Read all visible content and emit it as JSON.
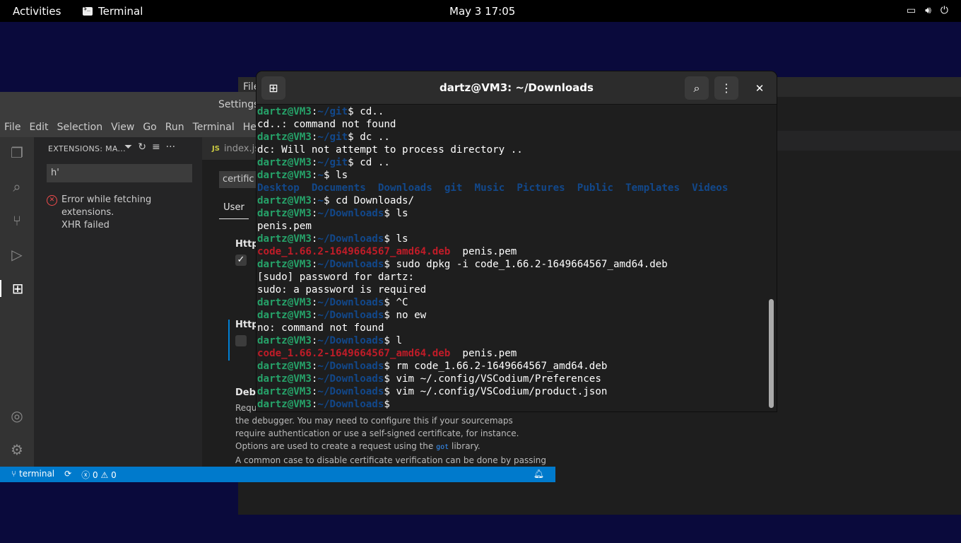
{
  "topbar": {
    "activities": "Activities",
    "app_name": "Terminal",
    "clock": "May 3  17:05",
    "tray": [
      "screen-icon",
      "volume-icon",
      "power-icon"
    ]
  },
  "bg_window": {
    "menu_first": "File"
  },
  "vscode": {
    "title": "Settings",
    "menu": [
      "File",
      "Edit",
      "Selection",
      "View",
      "Go",
      "Run",
      "Terminal",
      "He"
    ],
    "sidebar": {
      "header": "EXTENSIONS: MA...",
      "search_value": "h'",
      "error_line1": "Error while fetching extensions.",
      "error_line2": "XHR failed"
    },
    "editor": {
      "tab": "index.js",
      "tab_lang": "JS",
      "search_value": "certific",
      "user_tab": "User",
      "setting1_header": "Http:",
      "setting2_header": "Http:",
      "setting3_header": "Debu",
      "desc_line1": "Requ",
      "desc_line2": "the debugger. You may need to configure this if your sourcemaps",
      "desc_line3": "require authentication or use a self-signed certificate, for instance.",
      "desc_line4a": "Options are used to create a request using the ",
      "desc_code": "got",
      "desc_line4b": " library.",
      "desc_line5": "A common case to disable certificate verification can be done by passing"
    },
    "status": {
      "branch": "terminal",
      "errors": "0",
      "warnings": "0"
    }
  },
  "terminal": {
    "title": "dartz@VM3: ~/Downloads",
    "lines": [
      [
        {
          "t": "dartz@VM3",
          "c": "u"
        },
        {
          "t": ":",
          "c": ""
        },
        {
          "t": "~/git",
          "c": "p"
        },
        {
          "t": "$ cd..",
          "c": ""
        }
      ],
      [
        {
          "t": "cd..: command not found",
          "c": ""
        }
      ],
      [
        {
          "t": "dartz@VM3",
          "c": "u"
        },
        {
          "t": ":",
          "c": ""
        },
        {
          "t": "~/git",
          "c": "p"
        },
        {
          "t": "$ dc ..",
          "c": ""
        }
      ],
      [
        {
          "t": "dc: Will not attempt to process directory ..",
          "c": ""
        }
      ],
      [
        {
          "t": "dartz@VM3",
          "c": "u"
        },
        {
          "t": ":",
          "c": ""
        },
        {
          "t": "~/git",
          "c": "p"
        },
        {
          "t": "$ cd ..",
          "c": ""
        }
      ],
      [
        {
          "t": "dartz@VM3",
          "c": "u"
        },
        {
          "t": ":",
          "c": ""
        },
        {
          "t": "~",
          "c": "p"
        },
        {
          "t": "$ ls",
          "c": ""
        }
      ],
      [
        {
          "t": "Desktop",
          "c": "dir"
        },
        {
          "t": "  ",
          "c": ""
        },
        {
          "t": "Documents",
          "c": "dir"
        },
        {
          "t": "  ",
          "c": ""
        },
        {
          "t": "Downloads",
          "c": "dir"
        },
        {
          "t": "  ",
          "c": ""
        },
        {
          "t": "git",
          "c": "dir"
        },
        {
          "t": "  ",
          "c": ""
        },
        {
          "t": "Music",
          "c": "dir"
        },
        {
          "t": "  ",
          "c": ""
        },
        {
          "t": "Pictures",
          "c": "dir"
        },
        {
          "t": "  ",
          "c": ""
        },
        {
          "t": "Public",
          "c": "dir"
        },
        {
          "t": "  ",
          "c": ""
        },
        {
          "t": "Templates",
          "c": "dir"
        },
        {
          "t": "  ",
          "c": ""
        },
        {
          "t": "Videos",
          "c": "dir"
        }
      ],
      [
        {
          "t": "dartz@VM3",
          "c": "u"
        },
        {
          "t": ":",
          "c": ""
        },
        {
          "t": "~",
          "c": "p"
        },
        {
          "t": "$ cd Downloads/",
          "c": ""
        }
      ],
      [
        {
          "t": "dartz@VM3",
          "c": "u"
        },
        {
          "t": ":",
          "c": ""
        },
        {
          "t": "~/Downloads",
          "c": "p"
        },
        {
          "t": "$ ls",
          "c": ""
        }
      ],
      [
        {
          "t": "penis.pem",
          "c": ""
        }
      ],
      [
        {
          "t": "dartz@VM3",
          "c": "u"
        },
        {
          "t": ":",
          "c": ""
        },
        {
          "t": "~/Downloads",
          "c": "p"
        },
        {
          "t": "$ ls",
          "c": ""
        }
      ],
      [
        {
          "t": "code_1.66.2-1649664567_amd64.deb",
          "c": "deb"
        },
        {
          "t": "  penis.pem",
          "c": ""
        }
      ],
      [
        {
          "t": "dartz@VM3",
          "c": "u"
        },
        {
          "t": ":",
          "c": ""
        },
        {
          "t": "~/Downloads",
          "c": "p"
        },
        {
          "t": "$ sudo dpkg -i code_1.66.2-1649664567_amd64.deb",
          "c": ""
        }
      ],
      [
        {
          "t": "[sudo] password for dartz:",
          "c": ""
        }
      ],
      [
        {
          "t": "sudo: a password is required",
          "c": ""
        }
      ],
      [
        {
          "t": "dartz@VM3",
          "c": "u"
        },
        {
          "t": ":",
          "c": ""
        },
        {
          "t": "~/Downloads",
          "c": "p"
        },
        {
          "t": "$ ^C",
          "c": ""
        }
      ],
      [
        {
          "t": "dartz@VM3",
          "c": "u"
        },
        {
          "t": ":",
          "c": ""
        },
        {
          "t": "~/Downloads",
          "c": "p"
        },
        {
          "t": "$ no ew",
          "c": ""
        }
      ],
      [
        {
          "t": "no: command not found",
          "c": ""
        }
      ],
      [
        {
          "t": "dartz@VM3",
          "c": "u"
        },
        {
          "t": ":",
          "c": ""
        },
        {
          "t": "~/Downloads",
          "c": "p"
        },
        {
          "t": "$ l",
          "c": ""
        }
      ],
      [
        {
          "t": "code_1.66.2-1649664567_amd64.deb",
          "c": "deb"
        },
        {
          "t": "  penis.pem",
          "c": ""
        }
      ],
      [
        {
          "t": "dartz@VM3",
          "c": "u"
        },
        {
          "t": ":",
          "c": ""
        },
        {
          "t": "~/Downloads",
          "c": "p"
        },
        {
          "t": "$ rm code_1.66.2-1649664567_amd64.deb",
          "c": ""
        }
      ],
      [
        {
          "t": "dartz@VM3",
          "c": "u"
        },
        {
          "t": ":",
          "c": ""
        },
        {
          "t": "~/Downloads",
          "c": "p"
        },
        {
          "t": "$ vim ~/.config/VSCodium/Preferences",
          "c": ""
        }
      ],
      [
        {
          "t": "dartz@VM3",
          "c": "u"
        },
        {
          "t": ":",
          "c": ""
        },
        {
          "t": "~/Downloads",
          "c": "p"
        },
        {
          "t": "$ vim ~/.config/VSCodium/product.json",
          "c": ""
        }
      ],
      [
        {
          "t": "dartz@VM3",
          "c": "u"
        },
        {
          "t": ":",
          "c": ""
        },
        {
          "t": "~/Downloads",
          "c": "p"
        },
        {
          "t": "$ ",
          "c": ""
        }
      ]
    ]
  }
}
